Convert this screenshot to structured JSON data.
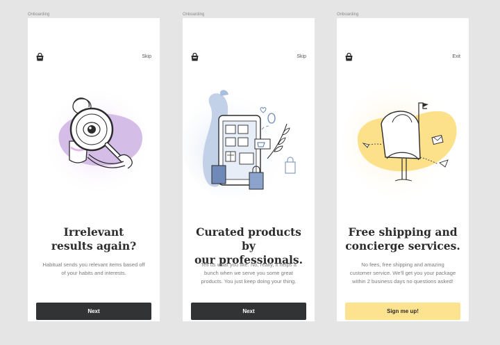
{
  "screens": [
    {
      "frame_label": "Onboarding",
      "top_action": "Skip",
      "title": "Irrelevant\nresults again?",
      "description": "Habitual sends you relevant items based off\nof your habits and interests.",
      "cta": "Next",
      "illustration": "magnifying-glass-person",
      "accent_color": "#e6d6f2"
    },
    {
      "frame_label": "Onboarding",
      "top_action": "Skip",
      "title": "Curated products by\nour professionals.",
      "description": "Tell us what you like. No, really, it helps a\nbunch when we serve you some great\nproducts. You just keep doing your thing.",
      "cta": "Next",
      "illustration": "phone-shopping",
      "accent_color": "#c9d6ea"
    },
    {
      "frame_label": "Onboarding",
      "top_action": "Exit",
      "title": "Free shipping and\nconcierge services.",
      "description": "No fees, free shipping and amazing\ncustomer service. We'll get you your package\nwithin 2 business days no questions asked!",
      "cta": "Sign me up!",
      "illustration": "mailbox",
      "accent_color": "#fde28f"
    }
  ],
  "colors": {
    "background": "#e5e5e5",
    "screen": "#ffffff",
    "button_dark": "#313335",
    "button_yellow": "#fde28f",
    "title_text": "#2b2b2b",
    "body_text": "#7a7a7a"
  }
}
